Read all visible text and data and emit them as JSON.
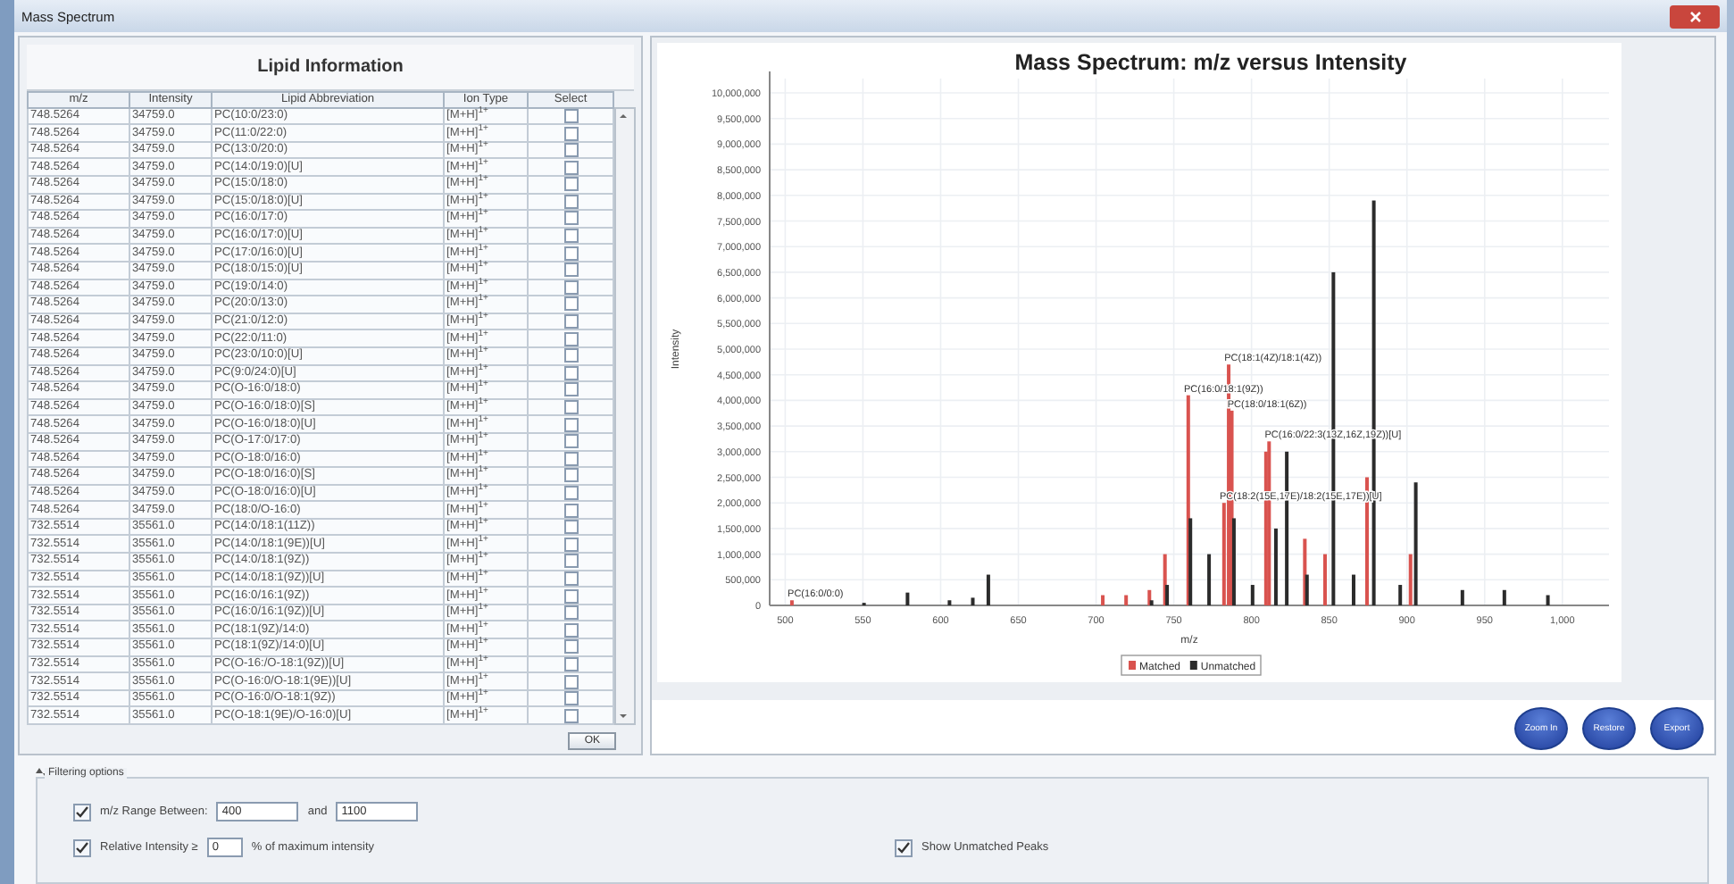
{
  "window": {
    "title": "Mass Spectrum"
  },
  "lipid_panel": {
    "title": "Lipid Information",
    "columns": [
      "m/z",
      "Intensity",
      "Lipid Abbreviation",
      "Ion Type",
      "Select"
    ],
    "rows": [
      {
        "mz": "748.5264",
        "intensity": "34759.0",
        "abbreviation": "PC(10:0/23:0)",
        "ion_type": "[M+H]$^{1+}$",
        "selected": false
      },
      {
        "mz": "748.5264",
        "intensity": "34759.0",
        "abbreviation": "PC(11:0/22:0)",
        "ion_type": "[M+H]$^{1+}$",
        "selected": false
      },
      {
        "mz": "748.5264",
        "intensity": "34759.0",
        "abbreviation": "PC(13:0/20:0)",
        "ion_type": "[M+H]$^{1+}$",
        "selected": false
      },
      {
        "mz": "748.5264",
        "intensity": "34759.0",
        "abbreviation": "PC(14:0/19:0)[U]",
        "ion_type": "[M+H]$^{1+}$",
        "selected": false
      },
      {
        "mz": "748.5264",
        "intensity": "34759.0",
        "abbreviation": "PC(15:0/18:0)",
        "ion_type": "[M+H]$^{1+}$",
        "selected": false
      },
      {
        "mz": "748.5264",
        "intensity": "34759.0",
        "abbreviation": "PC(15:0/18:0)[U]",
        "ion_type": "[M+H]$^{1+}$",
        "selected": false
      },
      {
        "mz": "748.5264",
        "intensity": "34759.0",
        "abbreviation": "PC(16:0/17:0)",
        "ion_type": "[M+H]$^{1+}$",
        "selected": false
      },
      {
        "mz": "748.5264",
        "intensity": "34759.0",
        "abbreviation": "PC(16:0/17:0)[U]",
        "ion_type": "[M+H]$^{1+}$",
        "selected": false
      },
      {
        "mz": "748.5264",
        "intensity": "34759.0",
        "abbreviation": "PC(17:0/16:0)[U]",
        "ion_type": "[M+H]$^{1+}$",
        "selected": false
      },
      {
        "mz": "748.5264",
        "intensity": "34759.0",
        "abbreviation": "PC(18:0/15:0)[U]",
        "ion_type": "[M+H]$^{1+}$",
        "selected": false
      },
      {
        "mz": "748.5264",
        "intensity": "34759.0",
        "abbreviation": "PC(19:0/14:0)",
        "ion_type": "[M+H]$^{1+}$",
        "selected": false
      },
      {
        "mz": "748.5264",
        "intensity": "34759.0",
        "abbreviation": "PC(20:0/13:0)",
        "ion_type": "[M+H]$^{1+}$",
        "selected": false
      },
      {
        "mz": "748.5264",
        "intensity": "34759.0",
        "abbreviation": "PC(21:0/12:0)",
        "ion_type": "[M+H]$^{1+}$",
        "selected": false
      },
      {
        "mz": "748.5264",
        "intensity": "34759.0",
        "abbreviation": "PC(22:0/11:0)",
        "ion_type": "[M+H]$^{1+}$",
        "selected": false
      },
      {
        "mz": "748.5264",
        "intensity": "34759.0",
        "abbreviation": "PC(23:0/10:0)[U]",
        "ion_type": "[M+H]$^{1+}$",
        "selected": false
      },
      {
        "mz": "748.5264",
        "intensity": "34759.0",
        "abbreviation": "PC(9:0/24:0)[U]",
        "ion_type": "[M+H]$^{1+}$",
        "selected": false
      },
      {
        "mz": "748.5264",
        "intensity": "34759.0",
        "abbreviation": "PC(O-16:0/18:0)",
        "ion_type": "[M+H]$^{1+}$",
        "selected": false
      },
      {
        "mz": "748.5264",
        "intensity": "34759.0",
        "abbreviation": "PC(O-16:0/18:0)[S]",
        "ion_type": "[M+H]$^{1+}$",
        "selected": false
      },
      {
        "mz": "748.5264",
        "intensity": "34759.0",
        "abbreviation": "PC(O-16:0/18:0)[U]",
        "ion_type": "[M+H]$^{1+}$",
        "selected": false
      },
      {
        "mz": "748.5264",
        "intensity": "34759.0",
        "abbreviation": "PC(O-17:0/17:0)",
        "ion_type": "[M+H]$^{1+}$",
        "selected": false
      },
      {
        "mz": "748.5264",
        "intensity": "34759.0",
        "abbreviation": "PC(O-18:0/16:0)",
        "ion_type": "[M+H]$^{1+}$",
        "selected": false
      },
      {
        "mz": "748.5264",
        "intensity": "34759.0",
        "abbreviation": "PC(O-18:0/16:0)[S]",
        "ion_type": "[M+H]$^{1+}$",
        "selected": false
      },
      {
        "mz": "748.5264",
        "intensity": "34759.0",
        "abbreviation": "PC(O-18:0/16:0)[U]",
        "ion_type": "[M+H]$^{1+}$",
        "selected": false
      },
      {
        "mz": "748.5264",
        "intensity": "34759.0",
        "abbreviation": "PC(18:0/O-16:0)",
        "ion_type": "[M+H]$^{1+}$",
        "selected": false
      },
      {
        "mz": "732.5514",
        "intensity": "35561.0",
        "abbreviation": "PC(14:0/18:1(11Z))",
        "ion_type": "[M+H]$^{1+}$",
        "selected": false
      },
      {
        "mz": "732.5514",
        "intensity": "35561.0",
        "abbreviation": "PC(14:0/18:1(9E))[U]",
        "ion_type": "[M+H]$^{1+}$",
        "selected": false
      },
      {
        "mz": "732.5514",
        "intensity": "35561.0",
        "abbreviation": "PC(14:0/18:1(9Z))",
        "ion_type": "[M+H]$^{1+}$",
        "selected": false
      },
      {
        "mz": "732.5514",
        "intensity": "35561.0",
        "abbreviation": "PC(14:0/18:1(9Z))[U]",
        "ion_type": "[M+H]$^{1+}$",
        "selected": false
      },
      {
        "mz": "732.5514",
        "intensity": "35561.0",
        "abbreviation": "PC(16:0/16:1(9Z))",
        "ion_type": "[M+H]$^{1+}$",
        "selected": false
      },
      {
        "mz": "732.5514",
        "intensity": "35561.0",
        "abbreviation": "PC(16:0/16:1(9Z))[U]",
        "ion_type": "[M+H]$^{1+}$",
        "selected": false
      },
      {
        "mz": "732.5514",
        "intensity": "35561.0",
        "abbreviation": "PC(18:1(9Z)/14:0)",
        "ion_type": "[M+H]$^{1+}$",
        "selected": false
      },
      {
        "mz": "732.5514",
        "intensity": "35561.0",
        "abbreviation": "PC(18:1(9Z)/14:0)[U]",
        "ion_type": "[M+H]$^{1+}$",
        "selected": false
      },
      {
        "mz": "732.5514",
        "intensity": "35561.0",
        "abbreviation": "PC(O-16:/O-18:1(9Z))[U]",
        "ion_type": "[M+H]$^{1+}$",
        "selected": false
      },
      {
        "mz": "732.5514",
        "intensity": "35561.0",
        "abbreviation": "PC(O-16:0/O-18:1(9E))[U]",
        "ion_type": "[M+H]$^{1+}$",
        "selected": false
      },
      {
        "mz": "732.5514",
        "intensity": "35561.0",
        "abbreviation": "PC(O-16:0/O-18:1(9Z))",
        "ion_type": "[M+H]$^{1+}$",
        "selected": false
      },
      {
        "mz": "732.5514",
        "intensity": "35561.0",
        "abbreviation": "PC(O-18:1(9E)/O-16:0)[U]",
        "ion_type": "[M+H]$^{1+}$",
        "selected": false
      }
    ],
    "ok_button": "OK"
  },
  "chart_panel": {
    "chart_data": {
      "type": "bar",
      "title": "Mass Spectrum: m/z versus Intensity",
      "xlabel": "m/z",
      "ylabel": "Intensity",
      "x": [
        505,
        550,
        578,
        605,
        620,
        630,
        705,
        720,
        735,
        745,
        760,
        772,
        783,
        786,
        788,
        800,
        810,
        812,
        815,
        822,
        835,
        848,
        852,
        865,
        875,
        878,
        895,
        903,
        905,
        935,
        962,
        990
      ],
      "series": [
        {
          "name": "Matched",
          "color": "#d9534f",
          "values": [
            100000,
            null,
            null,
            null,
            null,
            null,
            200000,
            200000,
            300000,
            1000000,
            4100000,
            null,
            2000000,
            4700000,
            3800000,
            null,
            3000000,
            3200000,
            null,
            null,
            1300000,
            1000000,
            null,
            null,
            2500000,
            null,
            null,
            1000000,
            null,
            null,
            null,
            null
          ]
        },
        {
          "name": "Unmatched",
          "color": "#2b2b2b",
          "values": [
            null,
            50000,
            250000,
            100000,
            150000,
            600000,
            null,
            null,
            100000,
            400000,
            1700000,
            1000000,
            null,
            null,
            1700000,
            400000,
            null,
            null,
            1500000,
            3000000,
            600000,
            null,
            6500000,
            600000,
            null,
            7900000,
            400000,
            null,
            2400000,
            300000,
            300000,
            200000
          ]
        }
      ],
      "xlim": [
        490,
        1030
      ],
      "ylim": [
        0,
        10000000
      ],
      "xticks": [
        500,
        550,
        600,
        650,
        700,
        750,
        800,
        850,
        900,
        950,
        {
          "value": 1000,
          "label": "1,000"
        }
      ],
      "yticks": [
        0,
        {
          "value": 500000,
          "label": "500,000"
        },
        {
          "value": 1000000,
          "label": "1,000,000"
        },
        {
          "value": 1500000,
          "label": "1,500,000"
        },
        {
          "value": 2000000,
          "label": "2,000,000"
        },
        {
          "value": 2500000,
          "label": "2,500,000"
        },
        {
          "value": 3000000,
          "label": "3,000,000"
        },
        {
          "value": 3500000,
          "label": "3,500,000"
        },
        {
          "value": 4000000,
          "label": "4,000,000"
        },
        {
          "value": 4500000,
          "label": "4,500,000"
        },
        {
          "value": 5000000,
          "label": "5,000,000"
        },
        {
          "value": 5500000,
          "label": "5,500,000"
        },
        {
          "value": 6000000,
          "label": "6,000,000"
        },
        {
          "value": 6500000,
          "label": "6,500,000"
        },
        {
          "value": 7000000,
          "label": "7,000,000"
        },
        {
          "value": 7500000,
          "label": "7,500,000"
        },
        {
          "value": 8000000,
          "label": "8,000,000"
        },
        {
          "value": 8500000,
          "label": "8,500,000"
        },
        {
          "value": 9000000,
          "label": "9,000,000"
        },
        {
          "value": 9500000,
          "label": "9,500,000"
        },
        {
          "value": 10000000,
          "label": "10,000,000"
        }
      ],
      "grid": true,
      "legend": true,
      "annotations": [
        {
          "x": 505,
          "y": 100000,
          "text": "PC(16:0/0:0)"
        },
        {
          "x": 786,
          "y": 4700000,
          "text": "PC(18:1(4Z)/18:1(4Z))"
        },
        {
          "x": 760,
          "y": 4100000,
          "text": "PC(16:0/18:1(9Z))"
        },
        {
          "x": 788,
          "y": 3800000,
          "text": "PC(18:0/18:1(6Z))"
        },
        {
          "x": 812,
          "y": 3200000,
          "text": "PC(16:0/22:3(13Z,16Z,19Z))[U]"
        },
        {
          "x": 783,
          "y": 2000000,
          "text": "PC(18:2(15E,17E)/18:2(15E,17E))[U]"
        }
      ]
    },
    "buttons": [
      "Zoom In",
      "Restore",
      "Export"
    ]
  },
  "filtering": {
    "title": "Filtering options",
    "mz_range": {
      "checked": true,
      "label": "m/z Range Between:",
      "from": "400",
      "and_label": "and",
      "to": "1100"
    },
    "relative_intensity": {
      "checked": true,
      "label": "Relative Intensity ≥",
      "value": "0",
      "suffix": "% of maximum intensity"
    },
    "show_unmatched": {
      "checked": true,
      "label": "Show Unmatched Peaks"
    }
  }
}
